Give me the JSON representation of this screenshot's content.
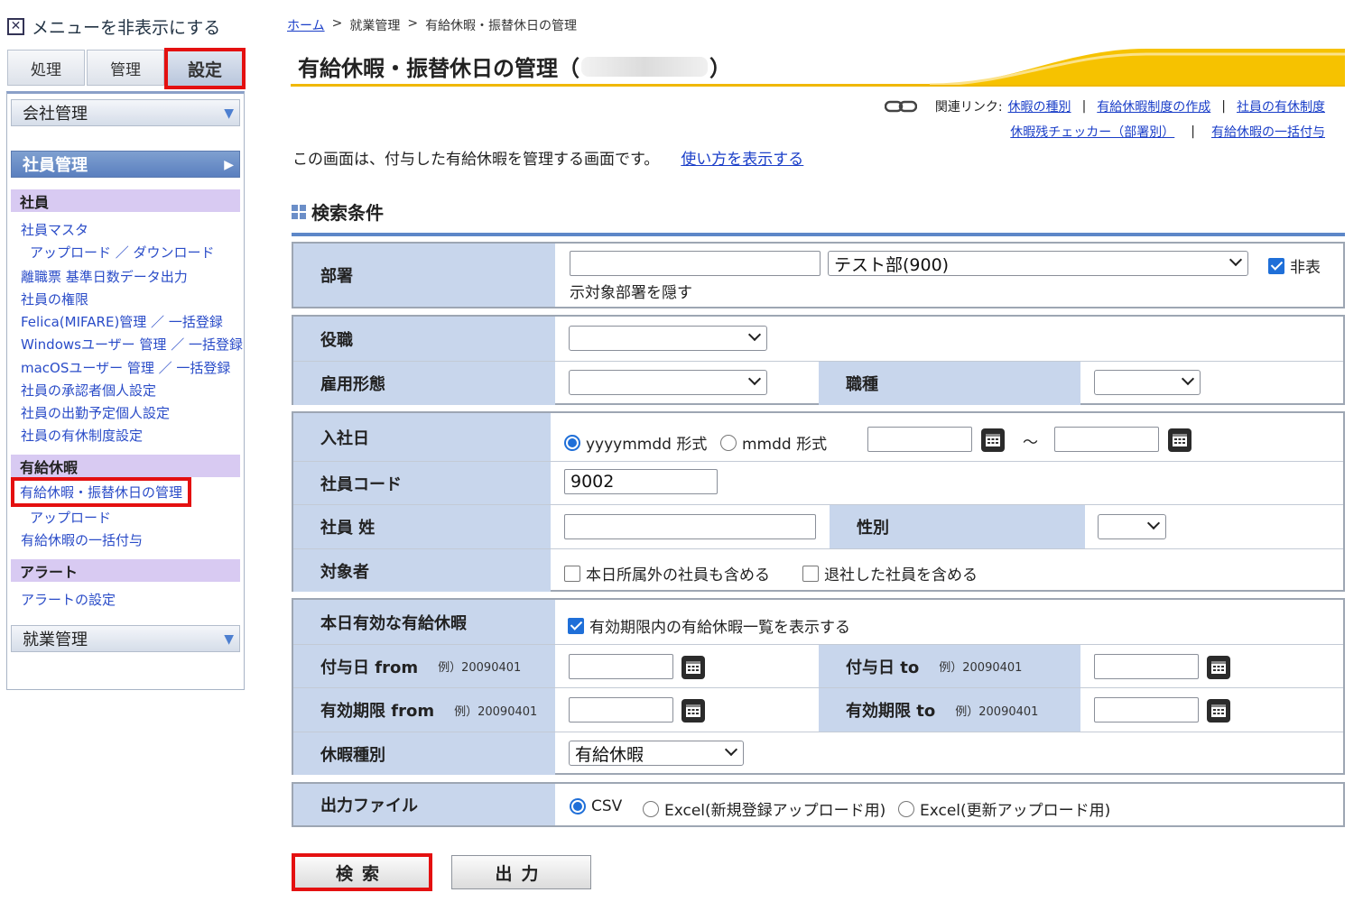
{
  "sidebar": {
    "hide_menu": "メニューを非表示にする",
    "tabs": [
      "処理",
      "管理",
      "設定"
    ],
    "categories": {
      "company": "会社管理",
      "employee": "社員管理",
      "work": "就業管理"
    },
    "sections": {
      "employee": "社員",
      "paid_leave": "有給休暇",
      "alert": "アラート"
    },
    "employee_links": [
      "社員マスタ",
      "アップロード ／ ダウンロード",
      "離職票 基準日数データ出力",
      "社員の権限",
      "Felica(MIFARE)管理 ／ 一括登録",
      "Windowsユーザー 管理 ／ 一括登録",
      "macOSユーザー 管理 ／ 一括登録",
      "社員の承認者個人設定",
      "社員の出勤予定個人設定",
      "社員の有休制度設定"
    ],
    "leave_links": [
      "有給休暇・振替休日の管理",
      "アップロード",
      "有給休暇の一括付与"
    ],
    "alert_links": [
      "アラートの設定"
    ]
  },
  "breadcrumb": {
    "home": "ホーム",
    "sep": ">",
    "work": "就業管理",
    "current": "有給休暇・振替休日の管理"
  },
  "page": {
    "title_prefix": "有給休暇・振替休日の管理（",
    "title_suffix": "）",
    "related_label": "関連リンク:",
    "related_links": [
      "休暇の種別",
      "有給休暇制度の作成",
      "社員の有休制度"
    ],
    "related_links2": [
      "休暇残チェッカー（部署別）",
      "有給休暇の一括付与"
    ],
    "separator": "|",
    "description": "この画面は、付与した有給休暇を管理する画面です。",
    "howto_link": "使い方を表示する",
    "search_heading": "検索条件"
  },
  "form": {
    "dept_label": "部署",
    "dept_text": "",
    "dept_select": "テスト部(900)",
    "dept_hide_label_1": "非表",
    "dept_hide_label_2": "示対象部署を隠す",
    "position_label": "役職",
    "employment_label": "雇用形態",
    "job_label": "職種",
    "hire_date_label": "入社日",
    "format_yyyymmdd": "yyyymmdd 形式",
    "format_mmdd": "mmdd 形式",
    "tilde": "～",
    "code_label": "社員コード",
    "code_value": "9002",
    "surname_label": "社員 姓",
    "gender_label": "性別",
    "target_label": "対象者",
    "target_opt1": "本日所属外の社員も含める",
    "target_opt2": "退社した社員を含める",
    "valid_label": "本日有効な有給休暇",
    "valid_opt": "有効期限内の有給休暇一覧を表示する",
    "grant_from_label": "付与日 from",
    "grant_to_label": "付与日 to",
    "expire_from_label": "有効期限 from",
    "expire_to_label": "有効期限 to",
    "example": "例）20090401",
    "leave_type_label": "休暇種別",
    "leave_type_value": "有給休暇",
    "output_label": "出力ファイル",
    "output_csv": "CSV",
    "output_excel_new": "Excel(新規登録アップロード用)",
    "output_excel_update": "Excel(更新アップロード用)"
  },
  "buttons": {
    "search": "検索",
    "output": "出力"
  },
  "colors": {
    "highlight": "#e41010",
    "label_bg": "#c8d6ec",
    "accent": "#f0b800",
    "link": "#1a3ec8"
  }
}
